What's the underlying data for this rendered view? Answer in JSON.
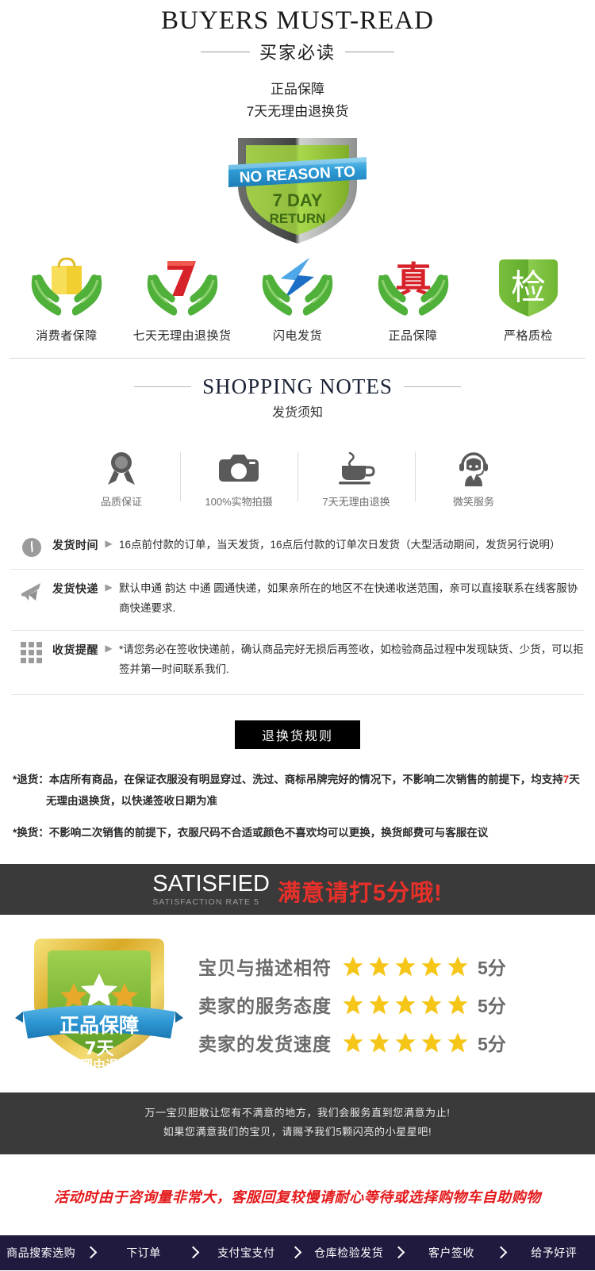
{
  "header": {
    "title_en": "BUYERS MUST-READ",
    "title_cn": "买家必读",
    "sub_line1": "正品保障",
    "sub_line2": "7天无理由退换货"
  },
  "shield_badge": {
    "ribbon_text": "NO REASON TO",
    "line1": "7 DAY",
    "line2": "RETURN",
    "color_shield": "#8CC63F",
    "color_ribbon": "#3BA7DD"
  },
  "guarantees": [
    {
      "label": "消费者保障",
      "icon": "shopping-bag-in-hands-icon"
    },
    {
      "label": "七天无理由退换货",
      "icon": "seven-in-hands-icon"
    },
    {
      "label": "闪电发货",
      "icon": "lightning-in-hands-icon"
    },
    {
      "label": "正品保障",
      "icon": "zhen-character-in-hands-icon"
    },
    {
      "label": "严格质检",
      "icon": "jian-shield-icon"
    }
  ],
  "notes": {
    "title_en": "SHOPPING NOTES",
    "title_cn": "发货须知"
  },
  "services": [
    {
      "label": "品质保证",
      "icon": "medal-icon"
    },
    {
      "label": "100%实物拍摄",
      "icon": "camera-icon"
    },
    {
      "label": "7天无理由退换",
      "icon": "coffee-cup-icon"
    },
    {
      "label": "微笑服务",
      "icon": "headset-agent-icon"
    }
  ],
  "info_rows": [
    {
      "icon": "clock-icon",
      "key": "发货时间",
      "value": "16点前付款的订单，当天发货，16点后付款的订单次日发货（大型活动期间，发货另行说明）"
    },
    {
      "icon": "airplane-icon",
      "key": "发货快递",
      "value": "默认申通 韵达 中通 圆通快递，如果亲所在的地区不在快递收送范围，亲可以直接联系在线客服协商快递要求."
    },
    {
      "icon": "grid-squares-icon",
      "key": "收货提醒",
      "value": "*请您务必在签收快递前，确认商品完好无损后再签收，如检验商品过程中发现缺货、少货，可以拒签并第一时间联系我们."
    }
  ],
  "return_policy": {
    "banner": "退换货规则",
    "item1_lead": "*退货：",
    "item1_text_a": "本店所有商品，在保证衣服没有明显穿过、洗过、商标吊牌完好的情况下，不影响二次销售的前提下，均支持",
    "item1_highlight": "7",
    "item1_text_b": "天",
    "item1_line2": "无理由退换货，以快递签收日期为准",
    "item2_lead": "*换货：",
    "item2_text": "不影响二次销售的前提下，衣服尺码不合适或颜色不喜欢均可以更换，换货邮费可与客服在议"
  },
  "satisfied": {
    "title_en": "SATISFIED",
    "title_en_sub": "SATISFACTION RATE 5",
    "title_cn": "满意请打5分哦!",
    "badge": {
      "ribbon": "正品保障",
      "line1": "7天",
      "line2": "无理由退换",
      "stars": 3
    },
    "ratings": [
      {
        "label": "宝贝与描述相符",
        "stars": 5,
        "score": "5分"
      },
      {
        "label": "卖家的服务态度",
        "stars": 5,
        "score": "5分"
      },
      {
        "label": "卖家的发货速度",
        "stars": 5,
        "score": "5分"
      }
    ],
    "foot_line1": "万一宝贝胆敢让您有不满意的地方，我们会服务直到您满意为止!",
    "foot_line2": "如果您满意我们的宝贝，请赐予我们5颗闪亮的小星星吧!"
  },
  "red_notice": "活动时由于咨询量非常大，客服回复较慢请耐心等待或选择购物车自助购物",
  "steps": [
    "商品搜索选购",
    "下订单",
    "支付宝支付",
    "仓库检验发货",
    "客户签收",
    "给予好评"
  ]
}
